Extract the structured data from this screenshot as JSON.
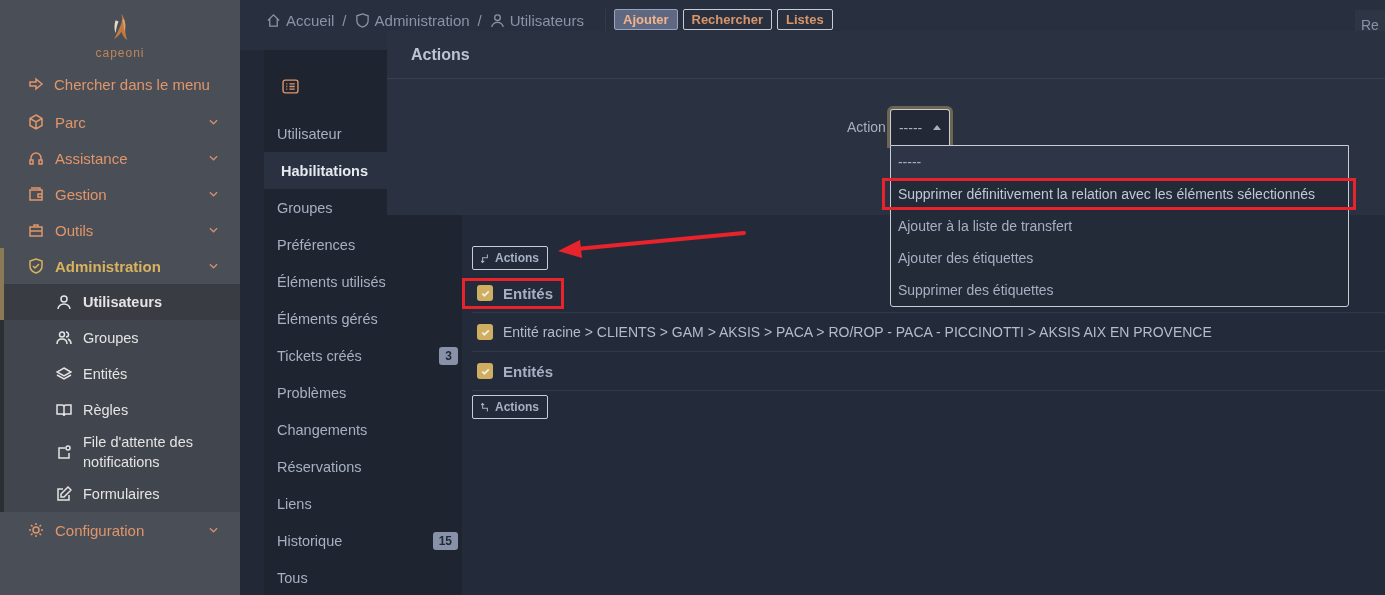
{
  "sidebar": {
    "logo_text": "capeoni",
    "search_label": "Chercher dans le menu",
    "items": [
      {
        "label": "Parc",
        "selected": false
      },
      {
        "label": "Assistance",
        "selected": false
      },
      {
        "label": "Gestion",
        "selected": false
      },
      {
        "label": "Outils",
        "selected": false
      },
      {
        "label": "Administration",
        "selected": true,
        "children": [
          {
            "label": "Utilisateurs",
            "selected": true
          },
          {
            "label": "Groupes",
            "selected": false
          },
          {
            "label": "Entités",
            "selected": false
          },
          {
            "label": "Règles",
            "selected": false
          },
          {
            "label": "File d'attente des notifications",
            "selected": false
          },
          {
            "label": "Formulaires",
            "selected": false
          }
        ]
      },
      {
        "label": "Configuration",
        "selected": false
      }
    ]
  },
  "breadcrumb": [
    {
      "label": "Accueil"
    },
    {
      "separator": "/",
      "label": "Administration"
    },
    {
      "separator": "/",
      "label": "Utilisateurs"
    }
  ],
  "header_buttons": [
    {
      "label": "Ajouter",
      "kind": "primary"
    },
    {
      "label": "Rechercher",
      "kind": "outline"
    },
    {
      "label": "Listes",
      "kind": "outline"
    }
  ],
  "header_cut_button": "Re",
  "tabs": [
    {
      "label": "Utilisateur",
      "selected": false
    },
    {
      "label": "Habilitations",
      "selected": true
    },
    {
      "label": "Groupes",
      "selected": false
    },
    {
      "label": "Préférences",
      "selected": false
    },
    {
      "label": "Éléments utilisés",
      "selected": false
    },
    {
      "label": "Éléments gérés",
      "selected": false
    },
    {
      "label": "Tickets créés",
      "selected": false,
      "badge": "3"
    },
    {
      "label": "Problèmes",
      "selected": false
    },
    {
      "label": "Changements",
      "selected": false
    },
    {
      "label": "Réservations",
      "selected": false
    },
    {
      "label": "Liens",
      "selected": false
    },
    {
      "label": "Historique",
      "selected": false,
      "badge": "15"
    },
    {
      "label": "Tous",
      "selected": false
    }
  ],
  "content": {
    "actions_top": "Actions",
    "actions_bottom": "Actions",
    "arrow_annotation": true,
    "rows": [
      {
        "kind": "header",
        "label": "Entités",
        "checked": true,
        "annotated": true
      },
      {
        "kind": "item",
        "label": "Entité racine > CLIENTS > GAM > AKSIS > PACA > RO/ROP - PACA - PICCINOTTI > AKSIS AIX EN PROVENCE",
        "checked": true,
        "annotated": false
      },
      {
        "kind": "header",
        "label": "Entités",
        "checked": true,
        "annotated": false
      }
    ]
  },
  "modal": {
    "title": "Actions",
    "field_label": "Action",
    "select_value": "-----",
    "expanded": true,
    "options": [
      {
        "label": "-----",
        "selected": true,
        "annotated": false
      },
      {
        "label": "Supprimer définitivement la relation avec les éléments sélectionnés",
        "selected": false,
        "annotated": true
      },
      {
        "label": "Ajouter à la liste de transfert",
        "selected": false,
        "annotated": false
      },
      {
        "label": "Ajouter des étiquettes",
        "selected": false,
        "annotated": false
      },
      {
        "label": "Supprimer des étiquettes",
        "selected": false,
        "annotated": false
      }
    ]
  }
}
